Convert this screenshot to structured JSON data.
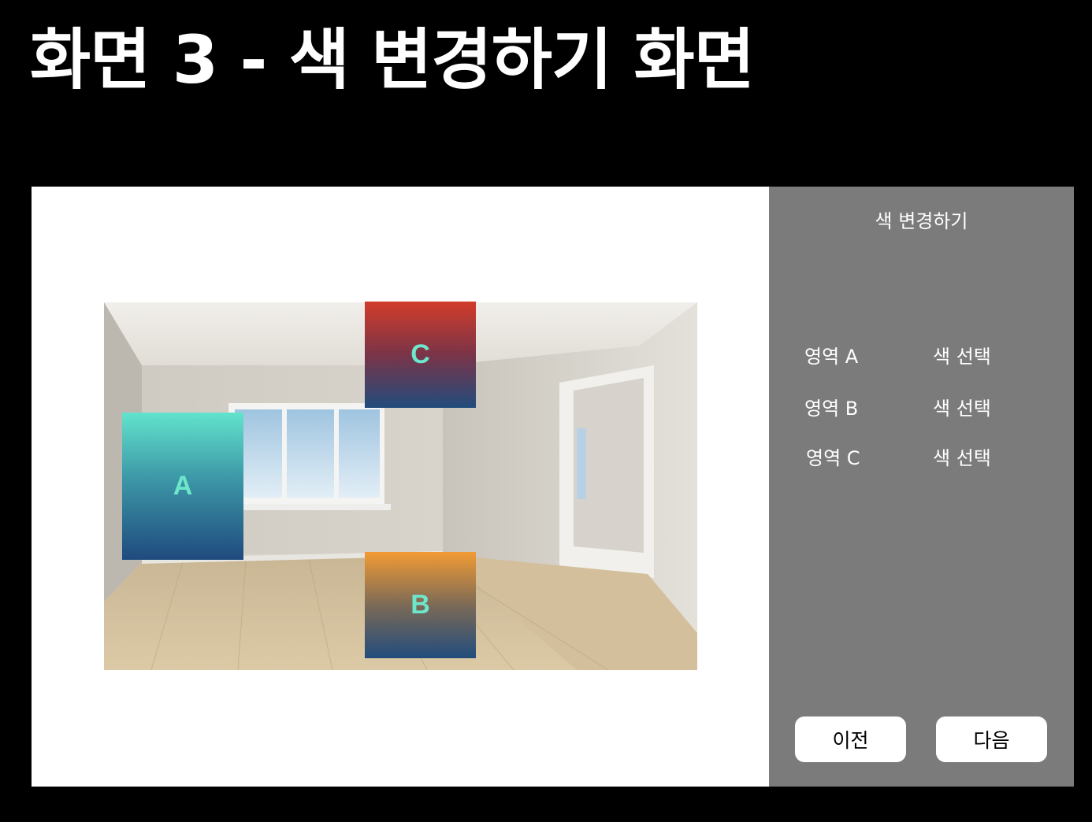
{
  "page": {
    "title": "화면 3 - 색 변경하기 화면"
  },
  "canvas": {
    "regions": {
      "a": {
        "label": "A",
        "gradient": [
          "#62e3cc",
          "#1f4a7e"
        ]
      },
      "b": {
        "label": "B",
        "gradient": [
          "#f29b34",
          "#224c7c"
        ]
      },
      "c": {
        "label": "C",
        "gradient": [
          "#d23c2a",
          "#224c7c"
        ]
      }
    },
    "region_label_color": "#6ee6cc"
  },
  "panel": {
    "title": "색 변경하기",
    "background": "#7b7b7b",
    "rows": [
      {
        "label": "영역 A",
        "action": "색 선택"
      },
      {
        "label": "영역 B",
        "action": "색 선택"
      },
      {
        "label": "영역 C",
        "action": "색 선택"
      }
    ],
    "prev_label": "이전",
    "next_label": "다음"
  }
}
